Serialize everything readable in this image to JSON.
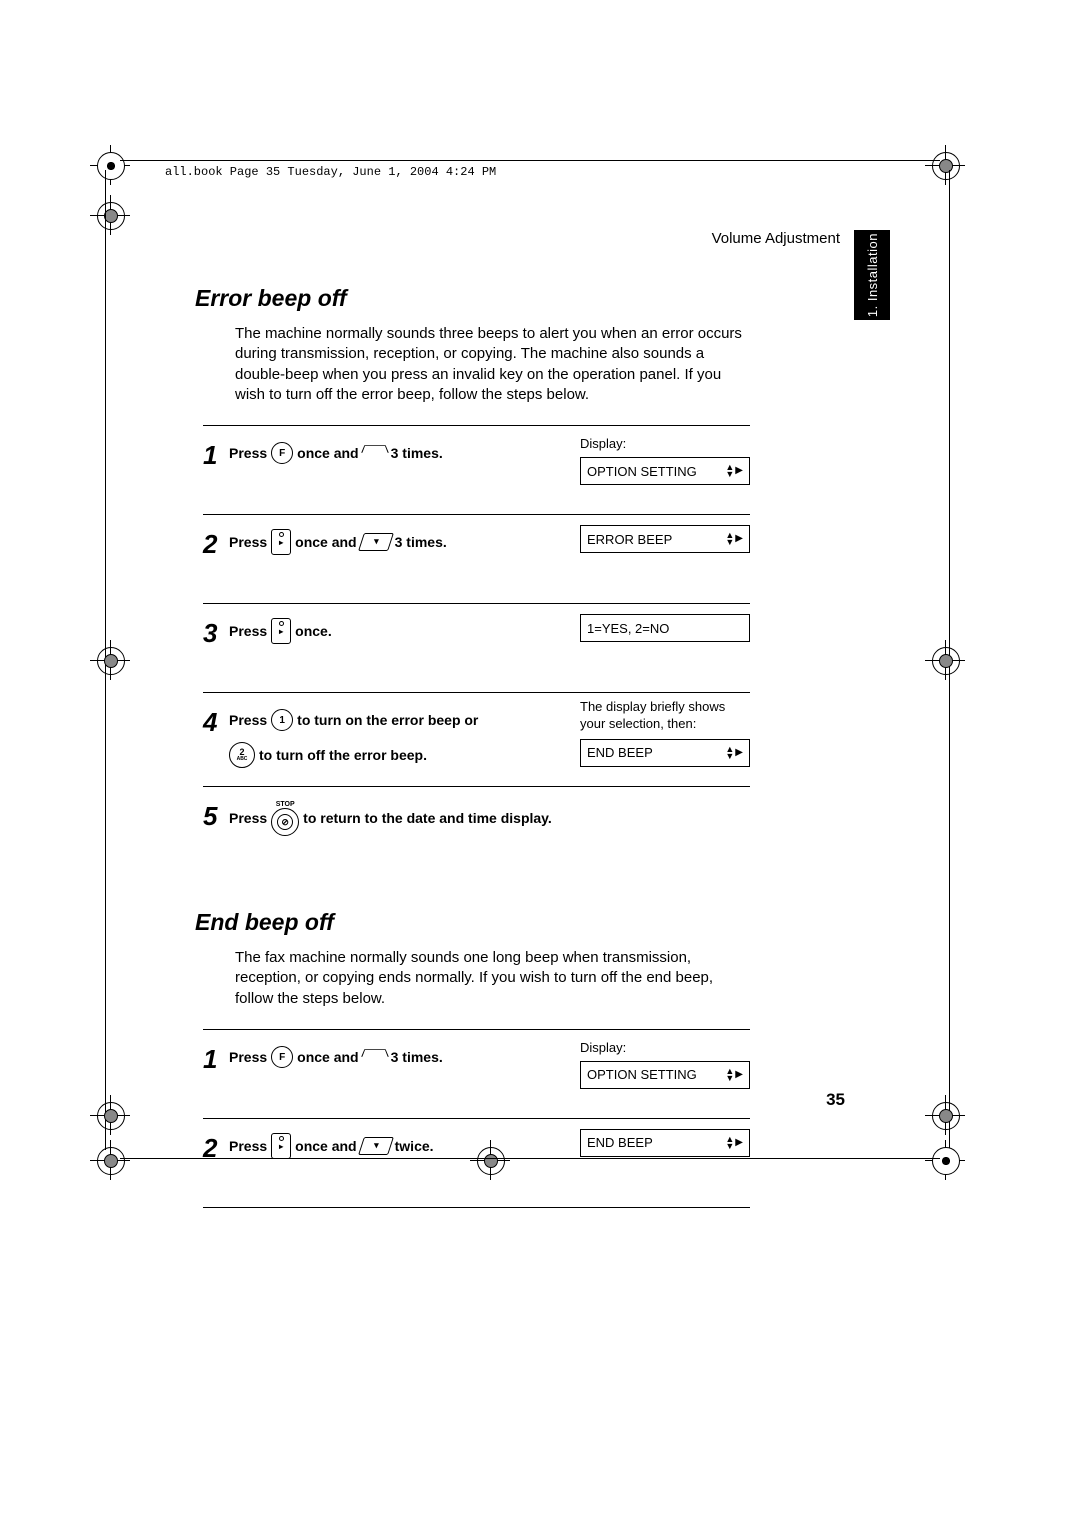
{
  "header_line": "all.book  Page 35  Tuesday, June 1, 2004  4:24 PM",
  "running_head": "Volume Adjustment",
  "section_tab": "1. Installation",
  "page_number": "35",
  "section1": {
    "title": "Error beep off",
    "intro": "The machine normally sounds three beeps to alert you when an error occurs during transmission, reception, or copying. The machine also sounds a double-beep when you press an invalid key on the operation panel. If you wish to turn off the error beep, follow the steps below.",
    "steps": [
      {
        "num": "1",
        "press": "Press",
        "btn1_label": "F",
        "mid": "once and",
        "btn2_label": "",
        "tail": "3 times.",
        "type": "f_then_house",
        "display_label": "Display:",
        "display_box": "OPTION SETTING"
      },
      {
        "num": "2",
        "press": "Press",
        "mid": "once and",
        "tail": "3 times.",
        "type": "tall_then_para",
        "display_box": "ERROR BEEP"
      },
      {
        "num": "3",
        "press": "Press",
        "mid": "once.",
        "type": "tall_only",
        "display_plain": "1=YES, 2=NO"
      },
      {
        "num": "4",
        "press": "Press",
        "line1_btn": "1",
        "line1_tail": "to turn on the error beep or",
        "line2_btn": "2",
        "line2_btn_sub": "ABC",
        "line2_tail": "to turn off the error beep.",
        "type": "two_choice",
        "display_note": "The display briefly shows your selection, then:",
        "display_box": "END BEEP"
      },
      {
        "num": "5",
        "press": "Press",
        "stop_label": "STOP",
        "tail": "to return to the date and time display.",
        "type": "stop"
      }
    ]
  },
  "section2": {
    "title": "End beep off",
    "intro": "The fax machine normally sounds one long beep when transmission, reception, or copying ends normally. If you wish to turn off the end beep, follow the steps below.",
    "steps": [
      {
        "num": "1",
        "press": "Press",
        "btn1_label": "F",
        "mid": "once and",
        "tail": "3 times.",
        "type": "f_then_house",
        "display_label": "Display:",
        "display_box": "OPTION SETTING"
      },
      {
        "num": "2",
        "press": "Press",
        "mid": "once and",
        "tail": "twice.",
        "type": "tall_then_para",
        "display_box": "END BEEP"
      }
    ]
  }
}
